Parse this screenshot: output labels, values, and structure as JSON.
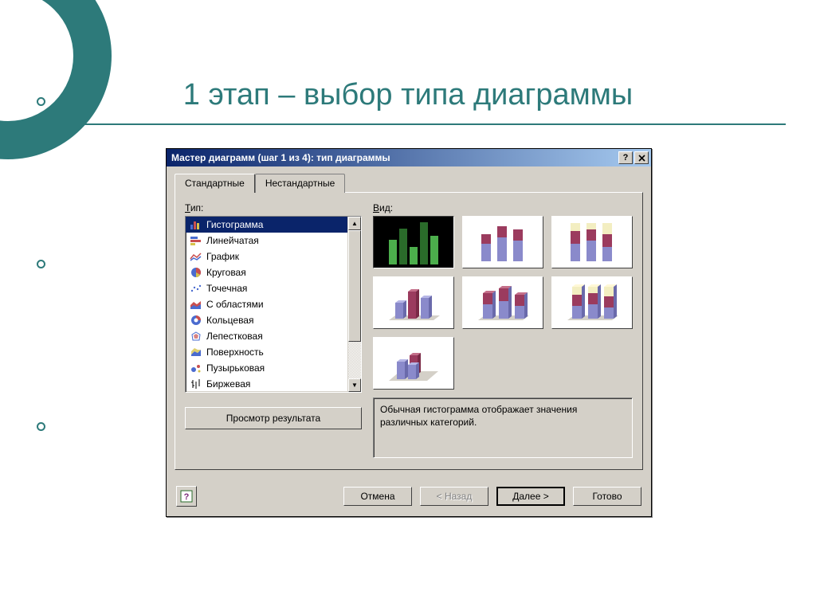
{
  "slide": {
    "title": "1 этап – выбор типа диаграммы"
  },
  "dialog": {
    "title": "Мастер диаграмм (шаг 1 из 4): тип диаграммы",
    "tabs": {
      "standard": "Стандартные",
      "custom": "Нестандартные"
    },
    "labels": {
      "type": "Тип:",
      "view": "Вид:"
    },
    "types": [
      "Гистограмма",
      "Линейчатая",
      "График",
      "Круговая",
      "Точечная",
      "С областями",
      "Кольцевая",
      "Лепестковая",
      "Поверхность",
      "Пузырьковая",
      "Биржевая"
    ],
    "selected_type_index": 0,
    "description": "Обычная гистограмма отображает значения различных категорий.",
    "preview_btn": "Просмотр результата",
    "footer": {
      "cancel": "Отмена",
      "back": "< Назад",
      "next": "Далее >",
      "finish": "Готово"
    }
  },
  "colors": {
    "accent": "#2d7a7a",
    "sel": "#0a246a",
    "bar_a": "#8a8acb",
    "bar_b": "#9b3b5e",
    "bar_c": "#f3eec1",
    "bar_g1": "#4cae4c",
    "bar_g2": "#2a6b2a"
  }
}
